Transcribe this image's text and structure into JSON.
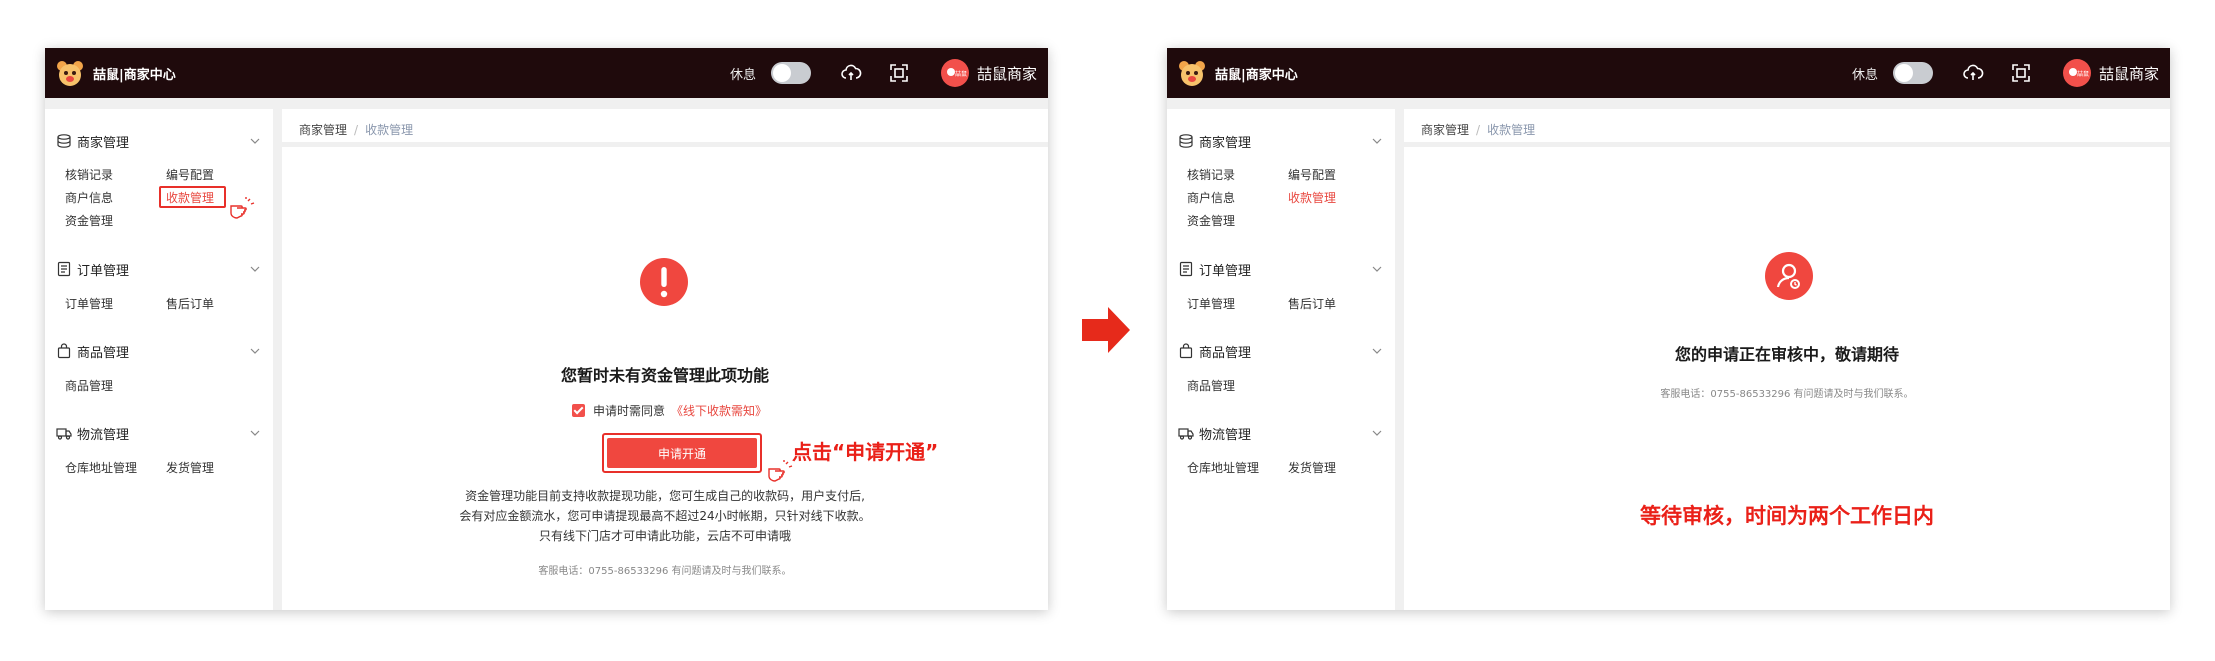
{
  "header": {
    "logo_text": "喆鼠|商家中心",
    "rest_label": "休息",
    "avatar_tag": "喆鼠",
    "shop_name": "喆鼠商家"
  },
  "sidebar": {
    "groups": [
      {
        "label": "商家管理",
        "icon": "database-icon",
        "items": [
          "核销记录",
          "编号配置",
          "商户信息",
          "收款管理",
          "资金管理"
        ]
      },
      {
        "label": "订单管理",
        "icon": "document-icon",
        "items": [
          "订单管理",
          "售后订单"
        ]
      },
      {
        "label": "商品管理",
        "icon": "shopping-bag-icon",
        "items": [
          "商品管理"
        ]
      },
      {
        "label": "物流管理",
        "icon": "truck-icon",
        "items": [
          "仓库地址管理",
          "发货管理"
        ]
      }
    ]
  },
  "breadcrumb": {
    "parent": "商家管理",
    "separator": "/",
    "current": "收款管理"
  },
  "left_content": {
    "title": "您暂时未有资金管理此项功能",
    "agree_text": "申请时需同意",
    "agree_link": "《线下收款需知》",
    "apply_button": "申请开通",
    "callout": "点击“申请开通”",
    "desc_lines": [
      "资金管理功能目前支持收款提现功能，您可生成自己的收款码，用户支付后,",
      "会有对应金额流水，您可申请提现最高不超过24小时帐期，只针对线下收款。",
      "只有线下门店才可申请此功能，云店不可申请哦"
    ],
    "service": "客服电话：0755-86533296 有问题请及时与我们联系。"
  },
  "right_content": {
    "title": "您的申请正在审核中，敬请期待",
    "service": "客服电话：0755-86533296 有问题请及时与我们联系。",
    "callout": "等待审核，时间为两个工作日内"
  },
  "colors": {
    "accent": "#f0473f",
    "header_bg": "#1f0a0c",
    "callout": "#ea2018"
  }
}
